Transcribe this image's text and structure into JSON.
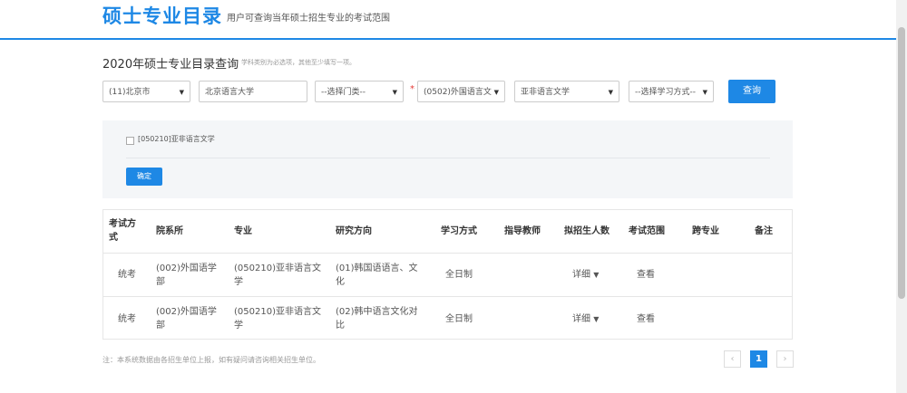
{
  "header": {
    "title": "硕士专业目录",
    "subtitle": "用户可查询当年硕士招生专业的考试范围"
  },
  "search": {
    "title": "2020年硕士专业目录查询",
    "hint": "学科类别为必选项，其他至少填写一项。",
    "province": "(11)北京市",
    "school": "北京语言大学",
    "category": "--选择门类--",
    "discipline": "(0502)外国语言文",
    "major": "亚非语言文学",
    "study_mode": "--选择学习方式--",
    "query_button": "查询",
    "arrow": "▼",
    "required_mark": "*"
  },
  "filter_panel": {
    "option_label": "[050210]亚非语言文学",
    "confirm_button": "确定"
  },
  "table": {
    "headers": [
      "考试方式",
      "院系所",
      "专业",
      "研究方向",
      "学习方式",
      "指导教师",
      "拟招生人数",
      "考试范围",
      "跨专业",
      "备注"
    ],
    "rows": [
      {
        "exam_type": "统考",
        "department": "(002)外国语学部",
        "major": "(050210)亚非语言文学",
        "direction": "(01)韩国语语言、文化",
        "study_mode": "全日制",
        "advisor": "",
        "quota": "详细",
        "quota_arrow": "▼",
        "scope": "查看",
        "cross": "",
        "note": ""
      },
      {
        "exam_type": "统考",
        "department": "(002)外国语学部",
        "major": "(050210)亚非语言文学",
        "direction": "(02)韩中语言文化对比",
        "study_mode": "全日制",
        "advisor": "",
        "quota": "详细",
        "quota_arrow": "▼",
        "scope": "查看",
        "cross": "",
        "note": ""
      }
    ]
  },
  "footer": {
    "note": "注：本系统数据由各招生单位上报，如有疑问请咨询相关招生单位。"
  },
  "pagination": {
    "prev": "‹",
    "current": "1",
    "next": "›"
  },
  "colors": {
    "accent": "#1e88e5",
    "required": "#e53935"
  }
}
